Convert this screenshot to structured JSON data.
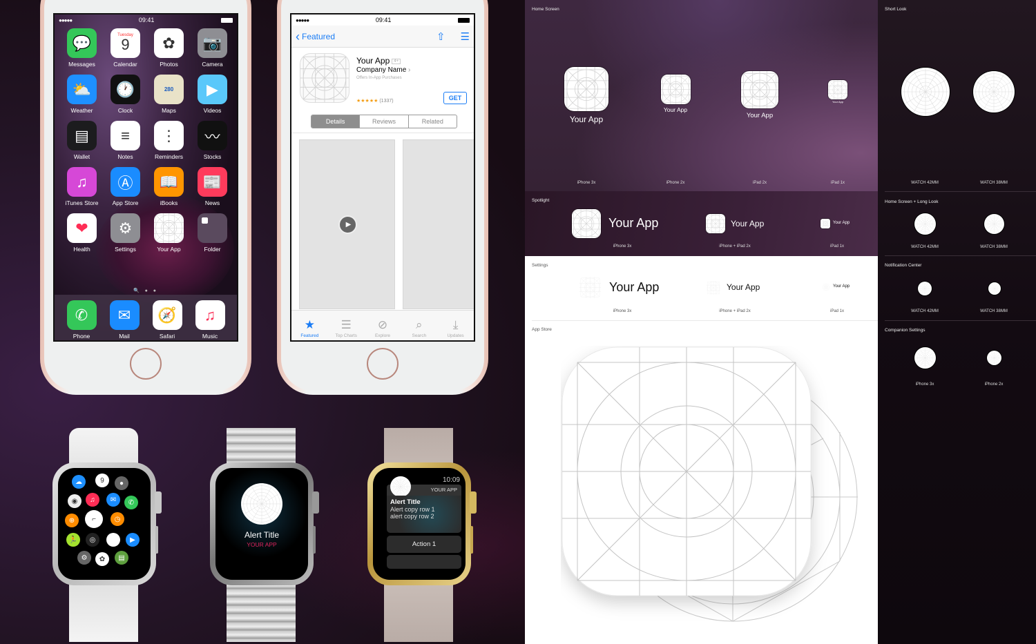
{
  "iphone_home": {
    "status": {
      "signal": "●●●●●",
      "time": "09:41"
    },
    "apps": [
      {
        "label": "Messages",
        "icon": "messages-icon",
        "glyph": "💬",
        "bg": "#34c759"
      },
      {
        "label": "Calendar",
        "icon": "calendar-icon",
        "glyph": "9",
        "day": "Tuesday",
        "bg": "#ffffff"
      },
      {
        "label": "Photos",
        "icon": "photos-icon",
        "glyph": "✿",
        "bg": "#ffffff"
      },
      {
        "label": "Camera",
        "icon": "camera-icon",
        "glyph": "📷",
        "bg": "#8e8e93"
      },
      {
        "label": "Weather",
        "icon": "weather-icon",
        "glyph": "⛅",
        "bg": "#1e90ff"
      },
      {
        "label": "Clock",
        "icon": "clock-icon",
        "glyph": "🕐",
        "bg": "#111111"
      },
      {
        "label": "Maps",
        "icon": "maps-icon",
        "glyph": "280",
        "bg": "#e9e2c8"
      },
      {
        "label": "Videos",
        "icon": "videos-icon",
        "glyph": "▶",
        "bg": "#5ac8fa"
      },
      {
        "label": "Wallet",
        "icon": "wallet-icon",
        "glyph": "▤",
        "bg": "#1c1c1e"
      },
      {
        "label": "Notes",
        "icon": "notes-icon",
        "glyph": "≡",
        "bg": "#ffffff"
      },
      {
        "label": "Reminders",
        "icon": "reminders-icon",
        "glyph": "⋮",
        "bg": "#ffffff"
      },
      {
        "label": "Stocks",
        "icon": "stocks-icon",
        "glyph": "〰",
        "bg": "#111111"
      },
      {
        "label": "iTunes Store",
        "icon": "itunes-store-icon",
        "glyph": "♫",
        "bg": "#d648d7"
      },
      {
        "label": "App Store",
        "icon": "app-store-icon",
        "glyph": "Ⓐ",
        "bg": "#1a8cff"
      },
      {
        "label": "iBooks",
        "icon": "ibooks-icon",
        "glyph": "📖",
        "bg": "#ff9500"
      },
      {
        "label": "News",
        "icon": "news-icon",
        "glyph": "📰",
        "bg": "#ff3b5c"
      },
      {
        "label": "Health",
        "icon": "health-icon",
        "glyph": "❤",
        "bg": "#ffffff"
      },
      {
        "label": "Settings",
        "icon": "settings-icon",
        "glyph": "⚙",
        "bg": "#8e8e93"
      },
      {
        "label": "Your App",
        "icon": "your-app-icon",
        "glyph": "",
        "bg": "#ffffff"
      },
      {
        "label": "Folder",
        "icon": "folder-icon",
        "glyph": "▪",
        "bg": "#5a4a5e"
      }
    ],
    "page_dots": "🔍 ● ●",
    "dock": [
      {
        "label": "Phone",
        "icon": "phone-icon",
        "glyph": "✆",
        "bg": "#34c759"
      },
      {
        "label": "Mail",
        "icon": "mail-icon",
        "glyph": "✉",
        "bg": "#1a8cff"
      },
      {
        "label": "Safari",
        "icon": "safari-icon",
        "glyph": "🧭",
        "bg": "#ffffff"
      },
      {
        "label": "Music",
        "icon": "music-icon",
        "glyph": "♫",
        "bg": "#ffffff"
      }
    ]
  },
  "iphone_appstore": {
    "status": {
      "signal": "●●●●●",
      "time": "09:41"
    },
    "nav": {
      "back_label": "Featured"
    },
    "app": {
      "name": "Your App",
      "age": "4+",
      "company": "Company Name",
      "company_chevron": "›",
      "iap": "Offers In-App Purchases",
      "stars": "★★★★★",
      "ratings": "(1337)",
      "get": "GET"
    },
    "segments": [
      {
        "label": "Details",
        "selected": true
      },
      {
        "label": "Reviews",
        "selected": false
      },
      {
        "label": "Related",
        "selected": false
      }
    ],
    "tabs": [
      {
        "label": "Featured",
        "icon": "star-icon",
        "glyph": "★",
        "active": true
      },
      {
        "label": "Top Charts",
        "icon": "list-icon",
        "glyph": "☰",
        "active": false
      },
      {
        "label": "Explore",
        "icon": "compass-icon",
        "glyph": "⊘",
        "active": false
      },
      {
        "label": "Search",
        "icon": "search-icon",
        "glyph": "⌕",
        "active": false
      },
      {
        "label": "Updates",
        "icon": "download-icon",
        "glyph": "⤓",
        "active": false
      }
    ]
  },
  "watches": {
    "sport": {
      "name": "Apple Watch Sport (white)"
    },
    "steel": {
      "alert_title": "Alert Title",
      "app_name": "YOUR APP"
    },
    "gold": {
      "time": "10:09",
      "app_name": "YOUR APP",
      "alert_title": "Alert Title",
      "row1": "Alert copy row 1",
      "row2": "alert copy row 2",
      "action": "Action 1"
    }
  },
  "templates": {
    "home_screen": {
      "title": "Home Screen",
      "app_name": "Your App",
      "sizes": [
        "iPhone 3x",
        "iPhone 2x",
        "iPad 2x",
        "iPad 1x"
      ]
    },
    "spotlight": {
      "title": "Spotlight",
      "app_name": "Your App",
      "sizes": [
        "iPhone 3x",
        "iPhone + iPad 2x",
        "iPad 1x"
      ]
    },
    "settings": {
      "title": "Settings",
      "app_name": "Your App",
      "sizes": [
        "iPhone 3x",
        "iPhone + iPad 2x",
        "iPad 1x"
      ]
    },
    "app_store": {
      "title": "App Store"
    }
  },
  "watch_templates": {
    "short_look": {
      "title": "Short Look",
      "sizes": [
        "WATCH 42MM",
        "WATCH 38MM"
      ]
    },
    "home_long_look": {
      "title": "Home Screen + Long Look",
      "sizes": [
        "WATCH 42MM",
        "WATCH 38MM"
      ]
    },
    "notification_center": {
      "title": "Notification Center",
      "sizes": [
        "WATCH 42MM",
        "WATCH 38MM"
      ]
    },
    "companion_settings": {
      "title": "Companion Settings",
      "sizes": [
        "iPhone 3x",
        "iPhone 2x"
      ]
    },
    "apple_glyph": ""
  }
}
